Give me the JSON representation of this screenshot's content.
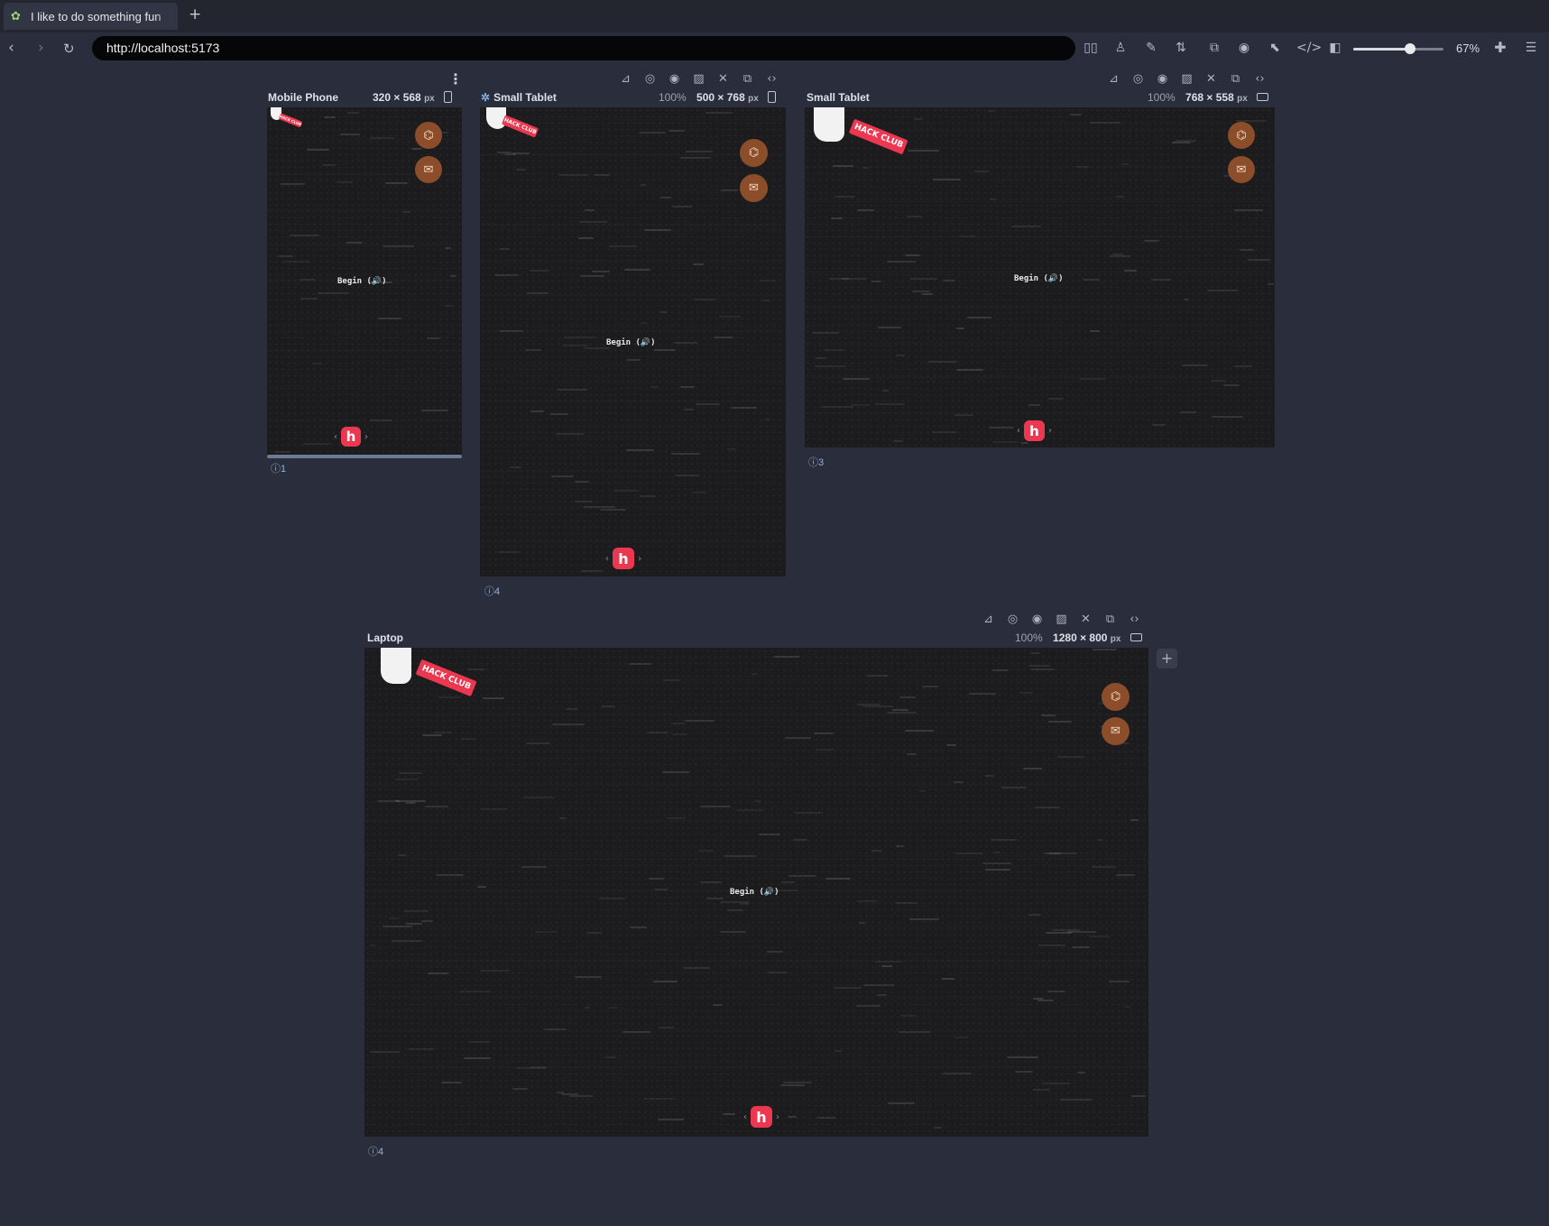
{
  "browser": {
    "tab_title": "I like to do something fun",
    "favicon": "polypane-icon",
    "new_tab": "+",
    "url": "http://localhost:5173",
    "zoom_label": "67%",
    "zoom_level_percent": 67
  },
  "devices": {
    "mobile": {
      "name": "Mobile Phone",
      "size": "320 × 568",
      "unit": "px",
      "badge": "1"
    },
    "tablet_portrait": {
      "name": "Small Tablet",
      "zoom": "100%",
      "size": "500 × 768",
      "unit": "px",
      "badge": "4"
    },
    "tablet_landscape": {
      "name": "Small Tablet",
      "zoom": "100%",
      "size": "768 × 558",
      "unit": "px",
      "badge": "3"
    },
    "laptop": {
      "name": "Laptop",
      "zoom": "100%",
      "size": "1280 × 800",
      "unit": "px",
      "badge": "4"
    }
  },
  "app": {
    "begin_label": "Begin (🔊)",
    "banner_text": "HACK CLUB",
    "hc_logo": "h",
    "colors": {
      "background": "#1c1c1e",
      "accent_red": "#ec3750",
      "social_brown": "#8c4d2a"
    },
    "social_icons": [
      "github-icon",
      "mail-icon"
    ]
  }
}
